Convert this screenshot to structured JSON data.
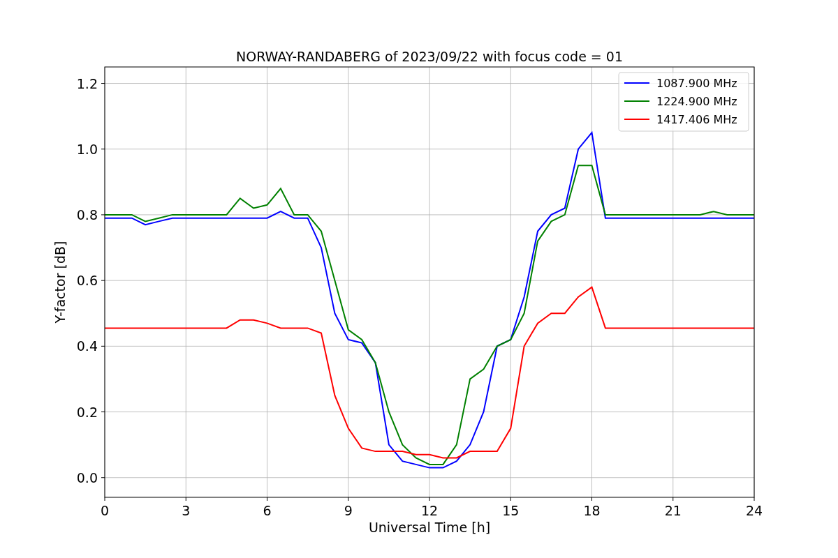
{
  "chart_data": {
    "type": "line",
    "title": "NORWAY-RANDABERG of 2023/09/22 with focus code = 01",
    "xlabel": "Universal Time [h]",
    "ylabel": "Y-factor [dB]",
    "x": [
      0,
      0.5,
      1,
      1.5,
      2,
      2.5,
      3,
      3.5,
      4,
      4.5,
      5,
      5.5,
      6,
      6.5,
      7,
      7.5,
      8,
      8.5,
      9,
      9.5,
      10,
      10.5,
      11,
      11.5,
      12,
      12.5,
      13,
      13.5,
      14,
      14.5,
      15,
      15.5,
      16,
      16.5,
      17,
      17.5,
      18,
      18.5,
      19,
      19.5,
      20,
      20.5,
      21,
      21.5,
      22,
      22.5,
      23,
      23.5,
      24
    ],
    "series": [
      {
        "name": "1087.900 MHz",
        "color": "#0000ff",
        "values": [
          0.79,
          0.79,
          0.79,
          0.77,
          0.78,
          0.79,
          0.79,
          0.79,
          0.79,
          0.79,
          0.79,
          0.79,
          0.79,
          0.81,
          0.79,
          0.79,
          0.7,
          0.5,
          0.42,
          0.41,
          0.35,
          0.1,
          0.05,
          0.04,
          0.03,
          0.03,
          0.05,
          0.1,
          0.2,
          0.4,
          0.42,
          0.55,
          0.75,
          0.8,
          0.82,
          1.0,
          1.05,
          0.79,
          0.79,
          0.79,
          0.79,
          0.79,
          0.79,
          0.79,
          0.79,
          0.79,
          0.79,
          0.79,
          0.79
        ]
      },
      {
        "name": "1224.900 MHz",
        "color": "#008000",
        "values": [
          0.8,
          0.8,
          0.8,
          0.78,
          0.79,
          0.8,
          0.8,
          0.8,
          0.8,
          0.8,
          0.85,
          0.82,
          0.83,
          0.88,
          0.8,
          0.8,
          0.75,
          0.6,
          0.45,
          0.42,
          0.35,
          0.2,
          0.1,
          0.06,
          0.04,
          0.04,
          0.1,
          0.3,
          0.33,
          0.4,
          0.42,
          0.5,
          0.72,
          0.78,
          0.8,
          0.95,
          0.95,
          0.8,
          0.8,
          0.8,
          0.8,
          0.8,
          0.8,
          0.8,
          0.8,
          0.81,
          0.8,
          0.8,
          0.8
        ]
      },
      {
        "name": "1417.406 MHz",
        "color": "#ff0000",
        "values": [
          0.455,
          0.455,
          0.455,
          0.455,
          0.455,
          0.455,
          0.455,
          0.455,
          0.455,
          0.455,
          0.48,
          0.48,
          0.47,
          0.455,
          0.455,
          0.455,
          0.44,
          0.25,
          0.15,
          0.09,
          0.08,
          0.08,
          0.08,
          0.07,
          0.07,
          0.06,
          0.06,
          0.08,
          0.08,
          0.08,
          0.15,
          0.4,
          0.47,
          0.5,
          0.5,
          0.55,
          0.58,
          0.455,
          0.455,
          0.455,
          0.455,
          0.455,
          0.455,
          0.455,
          0.455,
          0.455,
          0.455,
          0.455,
          0.455
        ]
      }
    ],
    "grid": true,
    "legend": true,
    "xlim": [
      0,
      24
    ],
    "ylim": [
      -0.06,
      1.25
    ],
    "xticks": [
      0,
      3,
      6,
      9,
      12,
      15,
      18,
      21,
      24
    ],
    "yticks": [
      {
        "value": 0,
        "label": "0.0"
      },
      {
        "value": 0.2,
        "label": "0.2"
      },
      {
        "value": 0.4,
        "label": "0.4"
      },
      {
        "value": 0.6,
        "label": "0.6"
      },
      {
        "value": 0.8,
        "label": "0.8"
      },
      {
        "value": 1,
        "label": "1.0"
      },
      {
        "value": 1.2,
        "label": "1.2"
      }
    ]
  }
}
